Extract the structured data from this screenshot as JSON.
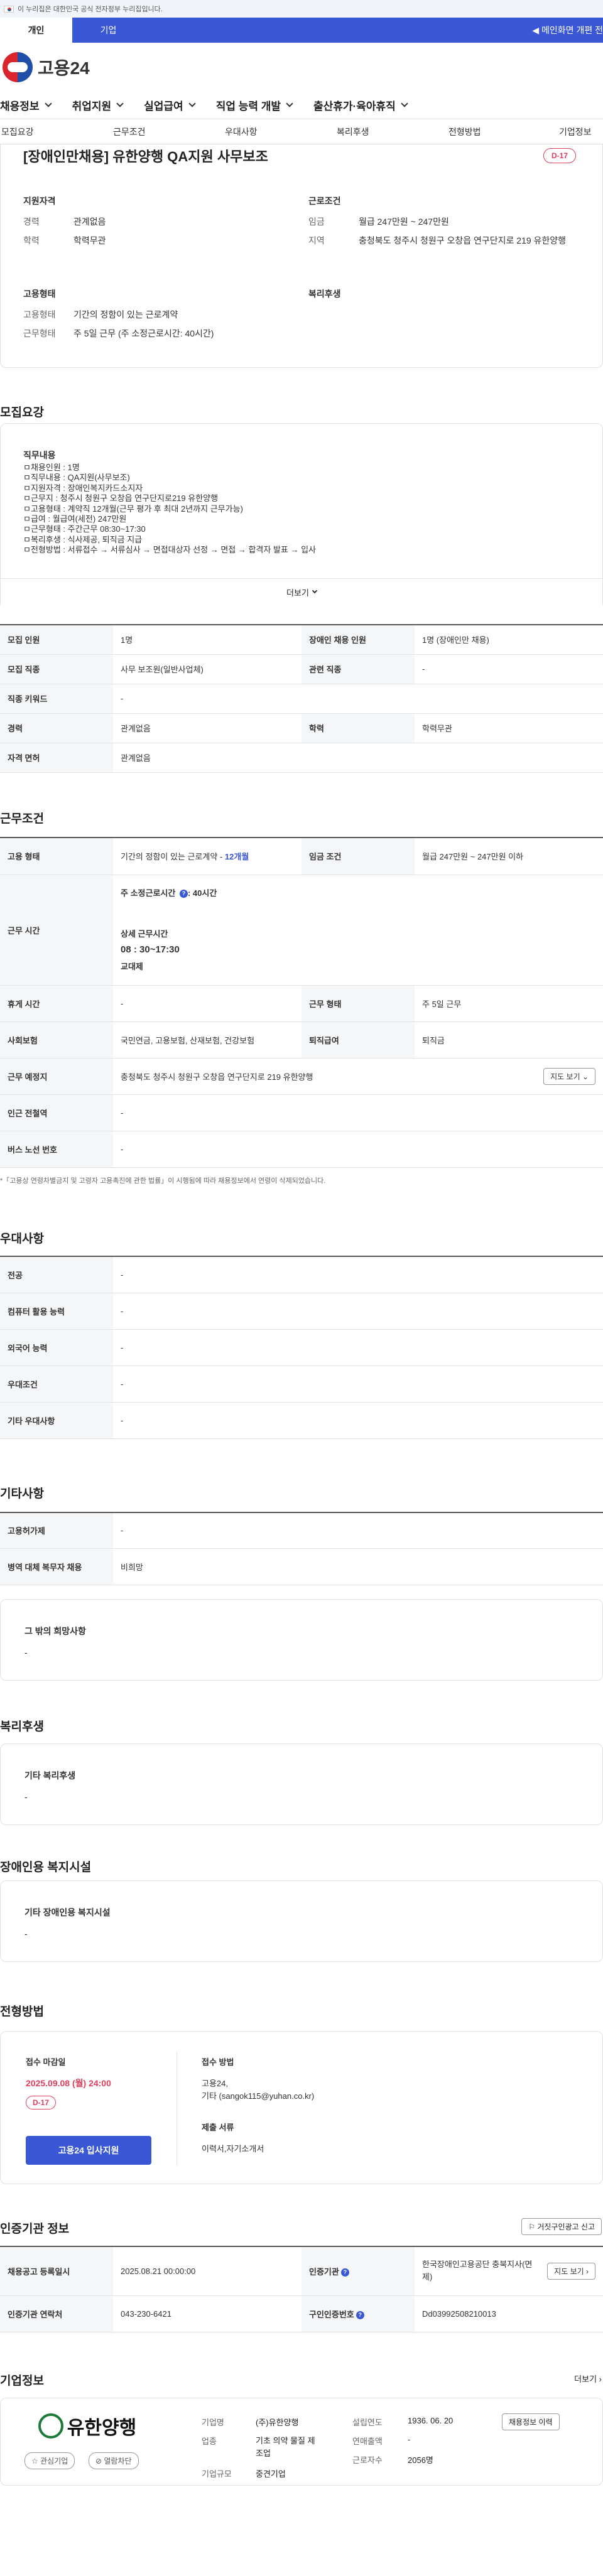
{
  "gov_notice": "이 누리집은 대한민국 공식 전자정부 누리집입니다.",
  "top_tabs": {
    "personal": "개인",
    "company": "기업",
    "right_link": "◀ 메인화면 개편 전"
  },
  "logo": {
    "text": "고용24"
  },
  "gnb": [
    {
      "label": "채용정보"
    },
    {
      "label": "취업지원"
    },
    {
      "label": "실업급여"
    },
    {
      "label": "직업 능력 개발"
    },
    {
      "label": "출산휴가·육아휴직"
    }
  ],
  "anchor_tabs": [
    "모집요강",
    "근무조건",
    "우대사항",
    "복리후생",
    "전형방법",
    "기업정보"
  ],
  "job": {
    "title": "[장애인만채용] 유한양행 QA지원 사무보조",
    "dday": "D-17",
    "qual_title": "지원자격",
    "qual": [
      {
        "k": "경력",
        "v": "관계없음"
      },
      {
        "k": "학력",
        "v": "학력무관"
      }
    ],
    "cond_title": "근로조건",
    "cond": [
      {
        "k": "임금",
        "v": "월급 247만원 ~ 247만원"
      },
      {
        "k": "지역",
        "v": "충청북도 청주시 청원구 오창읍 연구단지로 219 유한양행"
      }
    ],
    "type_title": "고용형태",
    "type": [
      {
        "k": "고용형태",
        "v": "기간의 정함이 있는 근로계약"
      },
      {
        "k": "근무형태",
        "v": "주 5일 근무 (주 소정근로시간: 40시간)"
      }
    ],
    "welfare_title": "복리후생"
  },
  "recruit": {
    "title": "모집요강",
    "duty_title": "직무내용",
    "duty_lines": [
      "ㅁ채용인원 : 1명",
      "ㅁ직무내용 : QA지원(사무보조)",
      "ㅁ지원자격 : 장애인복지카드소지자",
      "ㅁ근무지 : 청주시 청원구 오창읍 연구단지로219 유한양행",
      "ㅁ고용형태 : 계약직 12개월(근무 평가 후 최대 2년까지 근무가능)",
      "ㅁ급여 : 월급여(세전) 247만원",
      "ㅁ근무형태 : 주간근무 08:30~17:30",
      "ㅁ복리후생 : 식사제공, 퇴직금 지급",
      "ㅁ전형방법 : 서류접수 → 서류심사 → 면접대상자 선정 → 면접 → 합격자 발표 → 입사"
    ],
    "more": "더보기",
    "rows": [
      {
        "h1": "모집 인원",
        "v1": "1명",
        "h2": "장애인 채용 인원",
        "v2": "1명 (장애인만 채용)"
      },
      {
        "h1": "모집 직종",
        "v1": "사무 보조원(일반사업체)",
        "h2": "관련 직종",
        "v2": "-"
      },
      {
        "h1": "직종 키워드",
        "v1": "-"
      },
      {
        "h1": "경력",
        "v1": "관계없음",
        "h2": "학력",
        "v2": "학력무관"
      },
      {
        "h1": "자격 면허",
        "v1": "관계없음"
      }
    ]
  },
  "work": {
    "title": "근무조건",
    "emp_type_h": "고용 형태",
    "emp_type_v": "기간의 정함이 있는 근로계약 -",
    "emp_months": "12개월",
    "wage_h": "임금 조건",
    "wage_v": "월급 247만원 ~ 247만원 이하",
    "hours_h": "근무 시간",
    "hours_week": "주 소정근로시간",
    "hours_week_v": ": 40시간",
    "hours_detail_title": "상세 근무시간",
    "hours_detail": "08 : 30~17:30",
    "hours_shift": "교대제",
    "rest_h": "휴게 시간",
    "rest_v": "-",
    "form_h": "근무 형태",
    "form_v": "주 5일 근무",
    "ins_h": "사회보험",
    "ins_v": "국민연금, 고용보험, 산재보험, 건강보험",
    "sev_h": "퇴직급여",
    "sev_v": "퇴직금",
    "place_h": "근무 예정지",
    "place_v": "충청북도 청주시 청원구 오창읍 연구단지로 219 유한양행",
    "map_btn": "지도 보기",
    "subway_h": "인근 전철역",
    "subway_v": "-",
    "bus_h": "버스 노선 번호",
    "bus_v": "-",
    "note": "*「고용상 연령차별금지 및 고령자 고용촉진에 관한 법률」이 시행됨에 따라 채용정보에서 연령이 삭제되었습니다."
  },
  "pref": {
    "title": "우대사항",
    "rows": [
      {
        "h": "전공",
        "v": "-"
      },
      {
        "h": "컴퓨터 활용 능력",
        "v": "-"
      },
      {
        "h": "외국어 능력",
        "v": "-"
      },
      {
        "h": "우대조건",
        "v": "-"
      },
      {
        "h": "기타 우대사항",
        "v": "-"
      }
    ]
  },
  "etc": {
    "title": "기타사항",
    "rows": [
      {
        "h": "고용허가제",
        "v": "-"
      },
      {
        "h": "병역 대체 복무자 채용",
        "v": "비희망"
      }
    ],
    "other_title": "그 밖의 희망사항",
    "other_v": "-"
  },
  "welfare": {
    "title": "복리후생",
    "box_title": "기타 복리후생",
    "box_v": "-"
  },
  "disabled": {
    "title": "장애인용 복지시설",
    "box_title": "기타 장애인용 복지시설",
    "box_v": "-"
  },
  "process": {
    "title": "전형방법",
    "deadline_title": "접수 마감일",
    "deadline": "2025.09.08 (월) 24:00",
    "dday": "D-17",
    "apply_btn": "고용24 입사지원",
    "method_title": "접수 방법",
    "method_1": "고용24,",
    "method_2": "기타 (sangok115@yuhan.co.kr)",
    "docs_title": "제출 서류",
    "docs": "이력서,자기소개서"
  },
  "cert": {
    "title": "인증기관 정보",
    "report_btn": "거짓구인광고 신고",
    "reg_h": "채용공고 등록일시",
    "reg_v": "2025.08.21 00:00:00",
    "org_h": "인증기관",
    "org_v": "한국장애인고용공단 충북지사(면제)",
    "map_btn": "지도 보기",
    "tel_h": "인증기관 연락처",
    "tel_v": "043-230-6421",
    "no_h": "구인인증번호",
    "no_v": "Dd03992508210013"
  },
  "company": {
    "title": "기업정보",
    "more": "더보기",
    "logo_text": "유한양행",
    "fav_btn": "관심기업",
    "block_btn": "열람차단",
    "name_h": "기업명",
    "name_v": "(주)유한양행",
    "industry_h": "업종",
    "industry_v": "기초 의약 물질 제조업",
    "size_h": "기업규모",
    "size_v": "중견기업",
    "founded_h": "설립연도",
    "founded_v": "1936. 06. 20",
    "sales_h": "연매출액",
    "sales_v": "-",
    "staff_h": "근로자수",
    "staff_v": "2056명",
    "jobs_btn": "채용정보 이력"
  },
  "colors": {
    "primary": "#3a57d6",
    "accent_red": "#e03e5c"
  }
}
